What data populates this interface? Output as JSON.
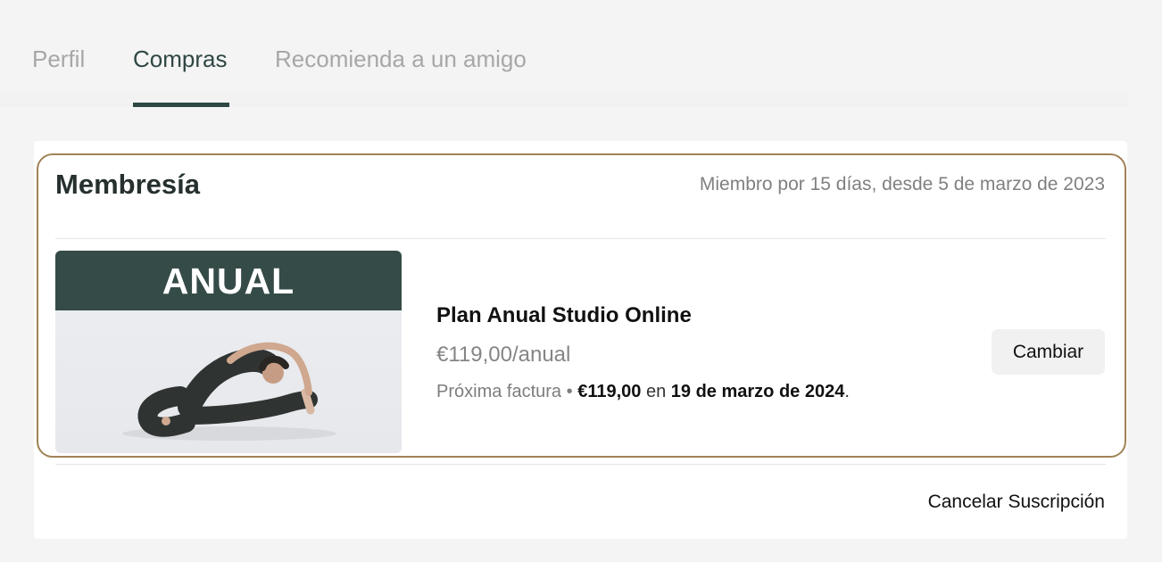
{
  "tabs": [
    {
      "label": "Perfil",
      "active": false
    },
    {
      "label": "Compras",
      "active": true
    },
    {
      "label": "Recomienda a un amigo",
      "active": false
    }
  ],
  "membership": {
    "title": "Membresía",
    "member_since": "Miembro por 15 días, desde 5 de marzo de 2023",
    "plan": {
      "image_label": "ANUAL",
      "name": "Plan Anual Studio Online",
      "price": "€119,00/anual",
      "next_invoice_label": "Próxima factura",
      "separator": "•",
      "next_invoice_amount": "€119,00",
      "next_invoice_connector": "en",
      "next_invoice_date": "19 de marzo de 2024",
      "next_invoice_end": "."
    },
    "change_button": "Cambiar",
    "cancel_link": "Cancelar Suscripción"
  },
  "colors": {
    "accent": "#2f4744",
    "highlight_border": "#a08256",
    "image_band": "#354b48",
    "page_background": "#f4f4f4"
  }
}
